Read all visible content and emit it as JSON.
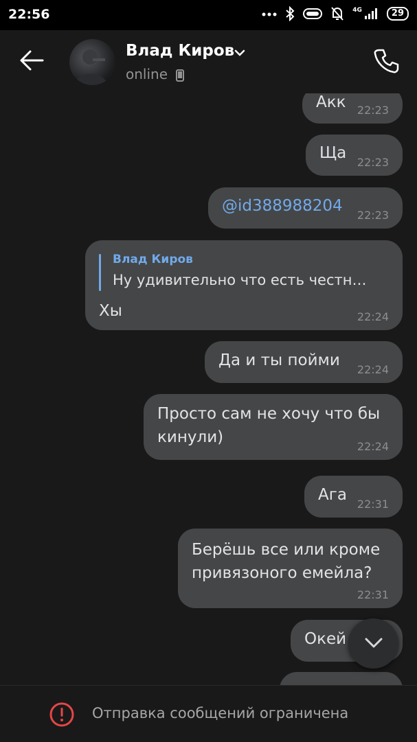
{
  "status_bar": {
    "time": "22:56",
    "network": "4G",
    "battery": "29"
  },
  "header": {
    "name": "Влад Киров",
    "status": "online"
  },
  "messages": [
    {
      "text": "Акк",
      "time": "22:23"
    },
    {
      "text": "Ща",
      "time": "22:23"
    },
    {
      "text": "@id388988204",
      "time": "22:23"
    },
    {
      "reply_name": "Влад Киров",
      "reply_text": "Ну удивительно что есть честн…",
      "text": "Хы",
      "time": "22:24"
    },
    {
      "text": "Да и ты пойми",
      "time": "22:24"
    },
    {
      "text": "Просто сам не хочу что бы\nкинули)",
      "time": "22:24"
    },
    {
      "text": "Ага",
      "time": "22:31"
    },
    {
      "text": "Берёшь все или кроме\nпривязоного емейла?",
      "time": "22:31"
    },
    {
      "text": "Окей",
      "time": ""
    }
  ],
  "footer": {
    "text": "Отправка сообщений ограничена"
  },
  "colors": {
    "background": "#19191a",
    "bubble": "#454647",
    "accent": "#71aaeb",
    "warning": "#e64646"
  }
}
